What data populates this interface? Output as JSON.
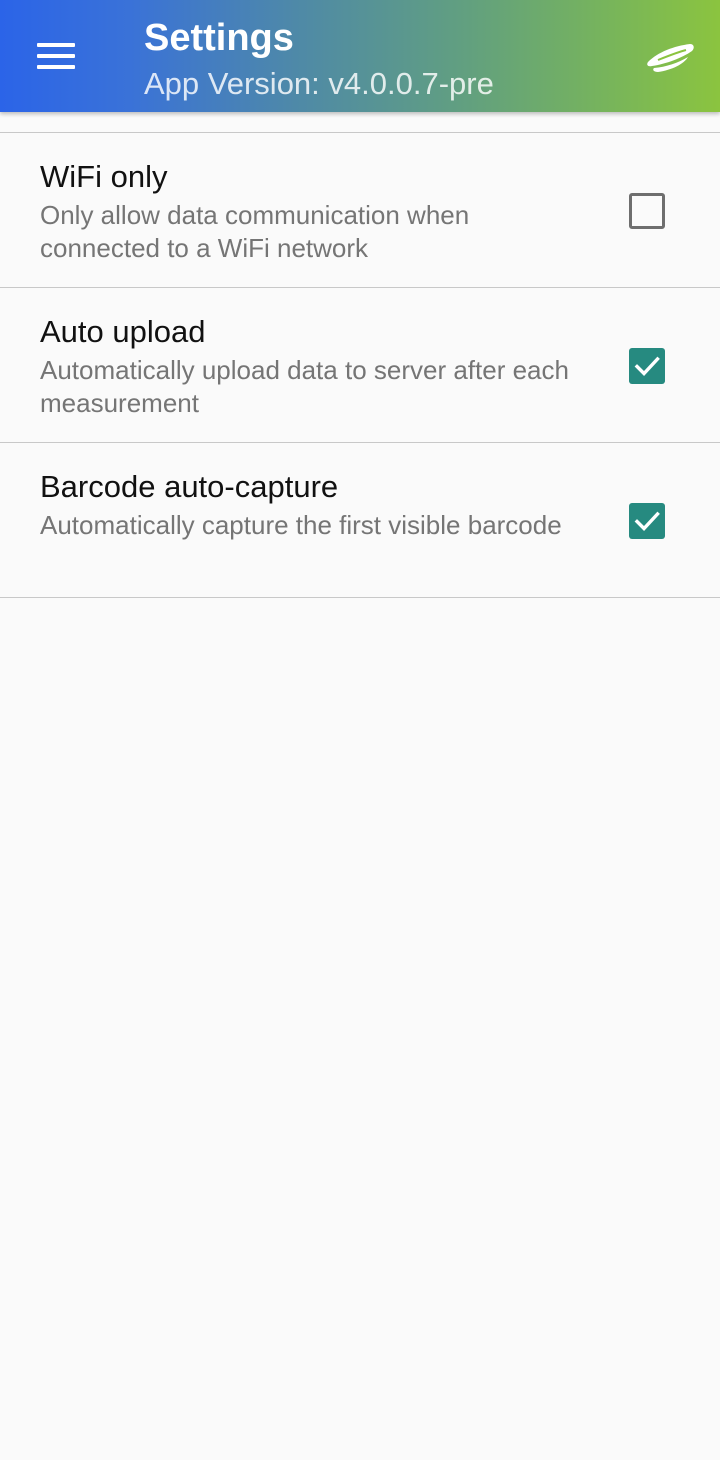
{
  "app_bar": {
    "title": "Settings",
    "subtitle": "App Version: v4.0.0.7-pre",
    "menu_icon": "hamburger-menu-icon",
    "logo_icon": "brand-logo-icon",
    "gradient_colors": [
      "#2b64e8",
      "#8bc43f"
    ]
  },
  "settings": [
    {
      "title": "WiFi only",
      "summary": "Only allow data communication when connected to a WiFi network",
      "checked": false
    },
    {
      "title": "Auto upload",
      "summary": "Automatically upload data to server after each measurement",
      "checked": true
    },
    {
      "title": "Barcode auto-capture",
      "summary": "Automatically capture the first visible barcode",
      "checked": true
    }
  ],
  "colors": {
    "checkbox_checked": "#268a80",
    "checkbox_unchecked_border": "#6e6e6e",
    "divider": "#c8c8c8",
    "background": "#fafafa"
  }
}
